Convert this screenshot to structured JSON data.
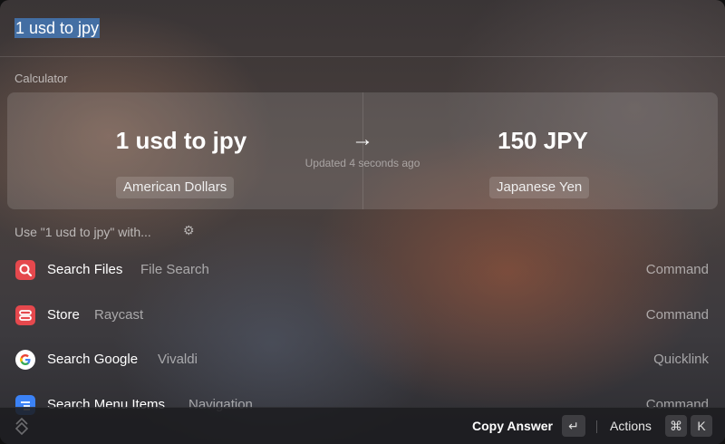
{
  "search": {
    "query": "1 usd to jpy"
  },
  "calculator": {
    "section_title": "Calculator",
    "input_expression": "1 usd to jpy",
    "arrow": "→",
    "result": "150 JPY",
    "updated": "Updated 4 seconds ago",
    "from_currency": "American Dollars",
    "to_currency": "Japanese Yen"
  },
  "use_with": {
    "label": "Use \"1 usd to jpy\" with...",
    "gear_icon": "⚙"
  },
  "items": [
    {
      "title": "Search Files",
      "subtitle": "File Search",
      "type": "Command",
      "icon": "magnifier-icon",
      "color": "#e5484d"
    },
    {
      "title": "Store",
      "subtitle": "Raycast",
      "type": "Command",
      "icon": "store-icon",
      "color": "#e5484d"
    },
    {
      "title": "Search Google",
      "subtitle": "Vivaldi",
      "type": "Quicklink",
      "icon": "google-icon",
      "color": "#ffffff"
    },
    {
      "title": "Search Menu Items",
      "subtitle": "Navigation",
      "type": "Command",
      "icon": "menu-items-icon",
      "color": "#3b82f6"
    }
  ],
  "footer": {
    "primary_action": "Copy Answer",
    "enter_key": "↵",
    "actions_label": "Actions",
    "cmd_key": "⌘",
    "k_key": "K"
  }
}
